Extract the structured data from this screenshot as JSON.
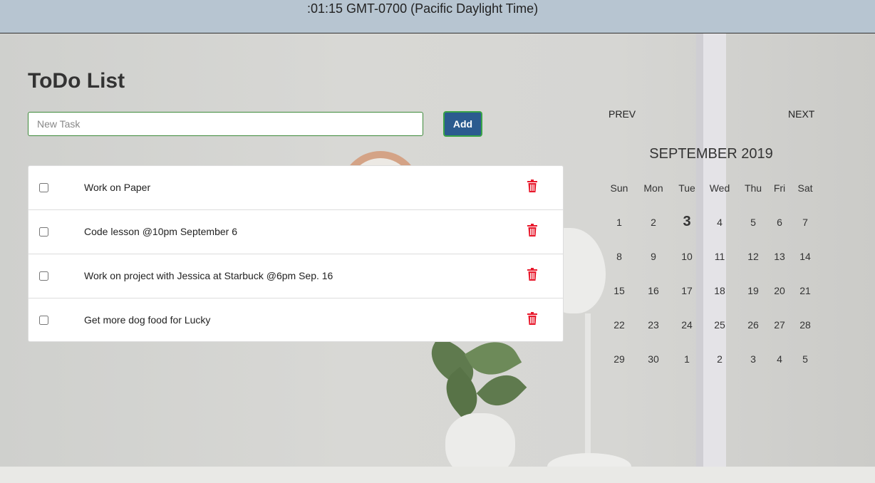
{
  "banner": {
    "text": ":01:15 GMT-0700 (Pacific Daylight Time)"
  },
  "todo": {
    "title": "ToDo List",
    "input_placeholder": "New Task",
    "input_value": "",
    "add_label": "Add",
    "tasks": [
      {
        "text": "Work on Paper",
        "checked": false
      },
      {
        "text": "Code lesson @10pm September 6",
        "checked": false
      },
      {
        "text": "Work on project with Jessica at Starbuck @6pm Sep. 16",
        "checked": false
      },
      {
        "text": "Get more dog food for Lucky",
        "checked": false
      }
    ],
    "delete_icon": "trash-icon",
    "delete_color": "#e8192c"
  },
  "calendar": {
    "prev_label": "PREV",
    "next_label": "NEXT",
    "month_label": "SEPTEMBER 2019",
    "weekdays": [
      "Sun",
      "Mon",
      "Tue",
      "Wed",
      "Thu",
      "Fri",
      "Sat"
    ],
    "weeks": [
      [
        "1",
        "2",
        "3",
        "4",
        "5",
        "6",
        "7"
      ],
      [
        "8",
        "9",
        "10",
        "11",
        "12",
        "13",
        "14"
      ],
      [
        "15",
        "16",
        "17",
        "18",
        "19",
        "20",
        "21"
      ],
      [
        "22",
        "23",
        "24",
        "25",
        "26",
        "27",
        "28"
      ],
      [
        "29",
        "30",
        "1",
        "2",
        "3",
        "4",
        "5"
      ]
    ],
    "today": "3"
  }
}
